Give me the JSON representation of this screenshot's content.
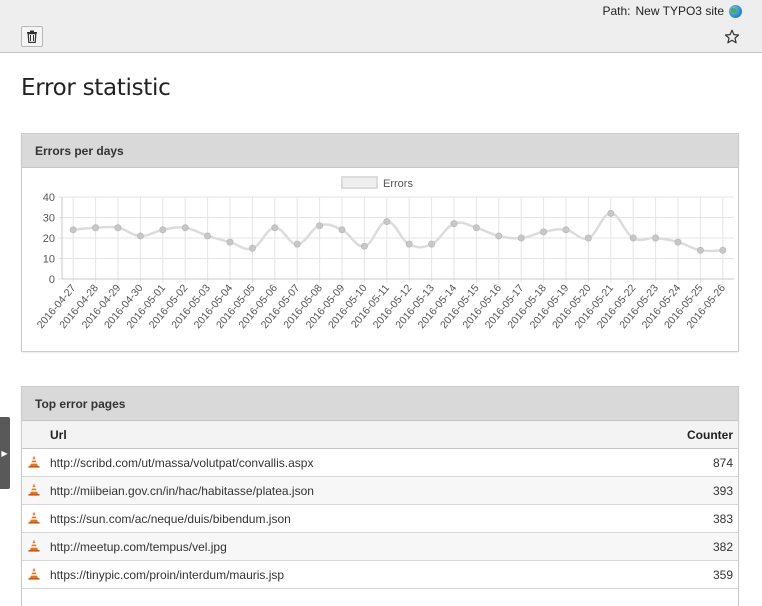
{
  "header": {
    "path_label": "Path:",
    "path_site": "New TYPO3 site"
  },
  "page": {
    "title": "Error statistic"
  },
  "chart_panel": {
    "heading": "Errors per days"
  },
  "chart_data": {
    "type": "line",
    "legend": "Errors",
    "legend_position": "top-center",
    "ylim": [
      0,
      40
    ],
    "yticks": [
      0,
      10,
      20,
      30,
      40
    ],
    "grid": true,
    "x": [
      "2016-04-27",
      "2016-04-28",
      "2016-04-29",
      "2016-04-30",
      "2016-05-01",
      "2016-05-02",
      "2016-05-03",
      "2016-05-04",
      "2016-05-05",
      "2016-05-06",
      "2016-05-07",
      "2016-05-08",
      "2016-05-09",
      "2016-05-10",
      "2016-05-11",
      "2016-05-12",
      "2016-05-13",
      "2016-05-14",
      "2016-05-15",
      "2016-05-16",
      "2016-05-17",
      "2016-05-18",
      "2016-05-19",
      "2016-05-20",
      "2016-05-21",
      "2016-05-22",
      "2016-05-23",
      "2016-05-24",
      "2016-05-25",
      "2016-05-26"
    ],
    "series": [
      {
        "name": "Errors",
        "values": [
          24,
          25,
          25,
          21,
          24,
          25,
          21,
          18,
          15,
          25,
          17,
          26,
          24,
          16,
          28,
          17,
          17,
          27,
          25,
          21,
          20,
          23,
          24,
          20,
          32,
          20,
          20,
          18,
          14,
          14
        ]
      }
    ],
    "colors": {
      "line": "#dcdcdc",
      "point": "#c8c8c8",
      "grid": "#e5e5e5"
    }
  },
  "pages_panel": {
    "heading": "Top error pages",
    "columns": {
      "url": "Url",
      "counter": "Counter"
    },
    "rows": [
      {
        "url": "http://scribd.com/ut/massa/volutpat/convallis.aspx",
        "counter": "874"
      },
      {
        "url": "http://miibeian.gov.cn/in/hac/habitasse/platea.json",
        "counter": "393"
      },
      {
        "url": "https://sun.com/ac/neque/duis/bibendum.json",
        "counter": "383"
      },
      {
        "url": "http://meetup.com/tempus/vel.jpg",
        "counter": "382"
      },
      {
        "url": "https://tinypic.com/proin/interdum/mauris.jsp",
        "counter": "359"
      }
    ]
  },
  "icons": {
    "trash": "trash-icon",
    "star": "star-icon",
    "globe": "globe-icon",
    "warning": "warning-cone-icon",
    "toggle": "chevron-right-icon"
  }
}
